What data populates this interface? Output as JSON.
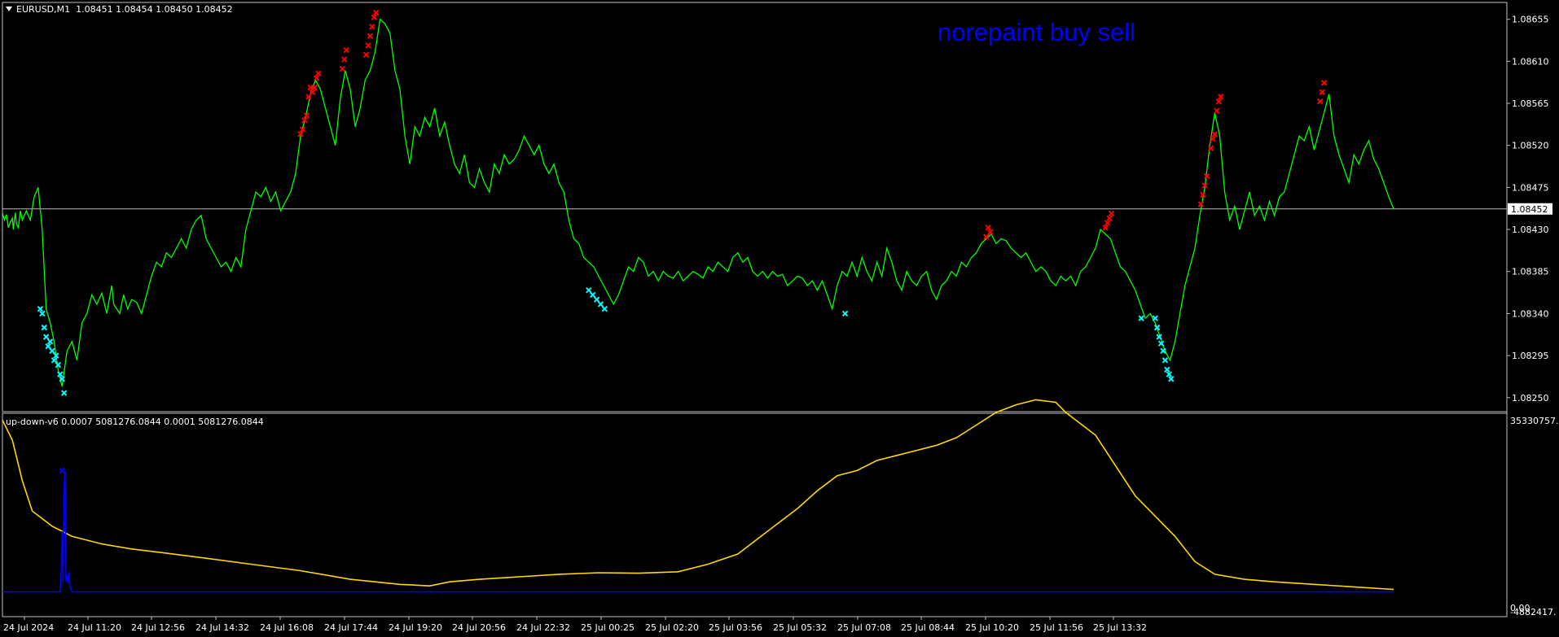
{
  "chart_data": [
    {
      "type": "line",
      "title": "EURUSD,M1",
      "ohlc": {
        "open": "1.08451",
        "high": "1.08454",
        "low": "1.08450",
        "close": "1.08452"
      },
      "y_ticks": [
        "1.08655",
        "1.08610",
        "1.08565",
        "1.08520",
        "1.08475",
        "1.08430",
        "1.08385",
        "1.08340",
        "1.08295",
        "1.08250"
      ],
      "ylim": [
        1.08235,
        1.08673
      ],
      "current_price": "1.08452",
      "series": [
        {
          "color": "#00ff00",
          "x": [
            0,
            2,
            4,
            6,
            8,
            10,
            11,
            12,
            13,
            14,
            16,
            18,
            20,
            24,
            28,
            32,
            36,
            40,
            44,
            48,
            52,
            56,
            60,
            65,
            70,
            75,
            80,
            85,
            90,
            95,
            100,
            105,
            110,
            112,
            118,
            122,
            126,
            130,
            135,
            140,
            145,
            150,
            155,
            160,
            165,
            170,
            175,
            180,
            185,
            190,
            195,
            200,
            205,
            210,
            215,
            220,
            225,
            230,
            235,
            240,
            245,
            250,
            255,
            260,
            265,
            270,
            275,
            280,
            285,
            290,
            295,
            300,
            305,
            310,
            315,
            320,
            325,
            330,
            335,
            340,
            345,
            350,
            355,
            360,
            365,
            370,
            375,
            380,
            385,
            390,
            395,
            400,
            405,
            410,
            415,
            420,
            425,
            430,
            435,
            440,
            445,
            450,
            455,
            460,
            465,
            470,
            475,
            480,
            485,
            490,
            495,
            500,
            505,
            510,
            515,
            520,
            525,
            530,
            535,
            540,
            545,
            550,
            555,
            560,
            565,
            570,
            575,
            580,
            585,
            590,
            595,
            600,
            605,
            610,
            615,
            620,
            625,
            630,
            635,
            640,
            645,
            650,
            655,
            660,
            665,
            670,
            675,
            680,
            685,
            690,
            695,
            700,
            705,
            710,
            715,
            720,
            725,
            730,
            735,
            740,
            745,
            750,
            755,
            760,
            765,
            770,
            775,
            780,
            785,
            790,
            795,
            800,
            805,
            810,
            815,
            820,
            825,
            830,
            835,
            840,
            845,
            850,
            855,
            860,
            865,
            870,
            875,
            880,
            885,
            890,
            895,
            900,
            905,
            910,
            915,
            920,
            925,
            930,
            935,
            940,
            945,
            950,
            955,
            960,
            965,
            970,
            975,
            980,
            985,
            990,
            995,
            1000,
            1005,
            1010,
            1015,
            1020,
            1025,
            1030,
            1035,
            1040,
            1045,
            1050,
            1055,
            1060,
            1065,
            1070,
            1075,
            1080,
            1085,
            1090,
            1095,
            1100,
            1105,
            1110,
            1115,
            1120,
            1125,
            1130,
            1135,
            1140,
            1145,
            1150,
            1155,
            1160,
            1165,
            1170,
            1175,
            1180,
            1185,
            1190,
            1195,
            1200,
            1205,
            1210,
            1215,
            1220,
            1225,
            1230,
            1235,
            1240,
            1245,
            1250,
            1255,
            1260,
            1265,
            1270,
            1275,
            1280,
            1285,
            1290,
            1295,
            1300,
            1305,
            1310,
            1315,
            1320,
            1325,
            1330,
            1335,
            1340,
            1345,
            1350,
            1355,
            1360,
            1365,
            1370,
            1375,
            1380,
            1385,
            1390,
            1395,
            1400
          ],
          "y": [
            1.08448,
            1.0844,
            1.08446,
            1.08432,
            1.08438,
            1.08442,
            1.0843,
            1.0844,
            1.08448,
            1.08436,
            1.08432,
            1.0845,
            1.0844,
            1.0845,
            1.0844,
            1.08465,
            1.08475,
            1.0843,
            1.08345,
            1.0833,
            1.0831,
            1.0828,
            1.08262,
            1.083,
            1.0831,
            1.0829,
            1.0833,
            1.0834,
            1.0836,
            1.0835,
            1.08362,
            1.0834,
            1.0837,
            1.0835,
            1.0834,
            1.0836,
            1.08345,
            1.08355,
            1.08352,
            1.0834,
            1.0836,
            1.0838,
            1.08395,
            1.0839,
            1.08405,
            1.084,
            1.0841,
            1.0842,
            1.0841,
            1.0843,
            1.0844,
            1.08445,
            1.0842,
            1.0841,
            1.084,
            1.0839,
            1.08395,
            1.08385,
            1.084,
            1.0839,
            1.0843,
            1.0845,
            1.0847,
            1.08465,
            1.08475,
            1.0846,
            1.0847,
            1.0845,
            1.0846,
            1.0847,
            1.0849,
            1.0853,
            1.0855,
            1.08575,
            1.0859,
            1.0858,
            1.0856,
            1.0854,
            1.0852,
            1.0857,
            1.086,
            1.0858,
            1.0854,
            1.0856,
            1.0859,
            1.086,
            1.0862,
            1.08655,
            1.0865,
            1.0864,
            1.086,
            1.0858,
            1.0853,
            1.085,
            1.0854,
            1.0853,
            1.0855,
            1.0854,
            1.0856,
            1.0853,
            1.08545,
            1.0852,
            1.085,
            1.0849,
            1.0851,
            1.0848,
            1.08475,
            1.08495,
            1.0848,
            1.0847,
            1.085,
            1.0849,
            1.0851,
            1.085,
            1.08505,
            1.08515,
            1.0853,
            1.0852,
            1.0851,
            1.0852,
            1.085,
            1.0849,
            1.085,
            1.0848,
            1.0847,
            1.0844,
            1.0842,
            1.08415,
            1.084,
            1.08395,
            1.0839,
            1.0838,
            1.0837,
            1.0836,
            1.0835,
            1.0836,
            1.08375,
            1.0839,
            1.08385,
            1.084,
            1.08395,
            1.0838,
            1.08385,
            1.08375,
            1.08385,
            1.0838,
            1.08378,
            1.08385,
            1.08375,
            1.0838,
            1.08385,
            1.08382,
            1.08378,
            1.0839,
            1.08385,
            1.08395,
            1.0839,
            1.08385,
            1.084,
            1.08405,
            1.08395,
            1.084,
            1.08385,
            1.0838,
            1.08385,
            1.08378,
            1.08385,
            1.0838,
            1.08382,
            1.0837,
            1.08375,
            1.0838,
            1.08378,
            1.0837,
            1.08375,
            1.08365,
            1.08375,
            1.0836,
            1.08345,
            1.0837,
            1.08385,
            1.0838,
            1.08395,
            1.0838,
            1.084,
            1.08385,
            1.08375,
            1.08395,
            1.0838,
            1.0841,
            1.08395,
            1.08375,
            1.08365,
            1.08385,
            1.08375,
            1.0837,
            1.0838,
            1.08385,
            1.08365,
            1.08355,
            1.0837,
            1.08375,
            1.08385,
            1.0838,
            1.08395,
            1.0839,
            1.084,
            1.08405,
            1.08415,
            1.0842,
            1.08425,
            1.08415,
            1.0842,
            1.08418,
            1.0841,
            1.08405,
            1.084,
            1.08405,
            1.08395,
            1.08385,
            1.0839,
            1.08385,
            1.08375,
            1.0837,
            1.0838,
            1.08375,
            1.0838,
            1.0837,
            1.08385,
            1.0839,
            1.084,
            1.0841,
            1.0843,
            1.08425,
            1.0842,
            1.08405,
            1.0839,
            1.08385,
            1.08375,
            1.08365,
            1.0835,
            1.08335,
            1.0834,
            1.0833,
            1.08315,
            1.083,
            1.0829,
            1.0831,
            1.0834,
            1.0837,
            1.0839,
            1.0841,
            1.08445,
            1.08475,
            1.0852,
            1.08555,
            1.0853,
            1.0847,
            1.0844,
            1.08455,
            1.0843,
            1.0845,
            1.0847,
            1.08445,
            1.08455,
            1.0844,
            1.0846,
            1.08445,
            1.08465,
            1.0847,
            1.0849,
            1.0851,
            1.0853,
            1.08525,
            1.0854,
            1.08515,
            1.08535,
            1.08555,
            1.08575,
            1.0853,
            1.0851,
            1.08495,
            1.0848,
            1.0851,
            1.085,
            1.08515,
            1.08525,
            1.08505,
            1.08495,
            1.0848,
            1.08465,
            1.08452
          ]
        }
      ],
      "sell_x": [
        300,
        302,
        304,
        306,
        308,
        310,
        312,
        314,
        316,
        318,
        342,
        344,
        346,
        366,
        368,
        370,
        372,
        374,
        376,
        990,
        992,
        994,
        1110,
        1112,
        1114,
        1116,
        1206,
        1208,
        1210,
        1212,
        1216,
        1218,
        1220,
        1222,
        1224,
        1226,
        1326,
        1328,
        1330
      ],
      "sell_y": [
        1.08532,
        1.08537,
        1.08547,
        1.08552,
        1.08572,
        1.08582,
        1.08577,
        1.08582,
        1.08592,
        1.08597,
        1.08602,
        1.08612,
        1.08622,
        1.08617,
        1.08627,
        1.08637,
        1.08647,
        1.08657,
        1.08662,
        1.08422,
        1.08432,
        1.08427,
        1.08432,
        1.08437,
        1.08442,
        1.08447,
        1.08457,
        1.08467,
        1.08477,
        1.08487,
        1.08517,
        1.08527,
        1.08532,
        1.08557,
        1.08567,
        1.08572,
        1.08567,
        1.08577,
        1.08587
      ],
      "buy_x": [
        38,
        40,
        42,
        44,
        46,
        48,
        50,
        52,
        54,
        56,
        58,
        60,
        62,
        590,
        594,
        598,
        602,
        606,
        848,
        1146,
        1160,
        1162,
        1164,
        1166,
        1168,
        1170,
        1172,
        1174,
        1176
      ],
      "buy_y": [
        1.08345,
        1.0834,
        1.08325,
        1.08315,
        1.08305,
        1.0831,
        1.083,
        1.0829,
        1.08295,
        1.08285,
        1.08275,
        1.0827,
        1.08255,
        1.08365,
        1.0836,
        1.08355,
        1.0835,
        1.08345,
        1.0834,
        1.08335,
        1.08335,
        1.08325,
        1.08315,
        1.08308,
        1.083,
        1.0829,
        1.0828,
        1.08275,
        1.0827
      ]
    },
    {
      "type": "line",
      "title": "up-down-v6",
      "values_label": "0.0007 5081276.0844 0.0001 5081276.0844",
      "y_top_label": "35330757.",
      "y_bottom_label": "-4882417.",
      "y_zero_label": "0.00",
      "ylim": [
        -4882417,
        35330757
      ],
      "series": [
        {
          "color": "#ffd700",
          "x": [
            0,
            10,
            20,
            30,
            40,
            50,
            60,
            70,
            80,
            100,
            130,
            160,
            200,
            250,
            300,
            350,
            400,
            430,
            450,
            480,
            520,
            560,
            600,
            640,
            680,
            710,
            740,
            770,
            800,
            820,
            840,
            860,
            880,
            900,
            920,
            940,
            960,
            980,
            1000,
            1020,
            1040,
            1060,
            1070,
            1080,
            1100,
            1120,
            1140,
            1160,
            1180,
            1200,
            1220,
            1250,
            1280,
            1320,
            1360,
            1400
          ],
          "y": [
            34000000,
            30000000,
            22000000,
            16000000,
            14500000,
            13000000,
            12000000,
            11000000,
            10500000,
            9500000,
            8500000,
            7800000,
            6800000,
            5500000,
            4200000,
            2500000,
            1500000,
            1200000,
            2000000,
            2500000,
            3000000,
            3500000,
            3800000,
            3700000,
            4000000,
            5500000,
            7500000,
            12000000,
            16500000,
            20000000,
            23000000,
            24000000,
            26000000,
            27000000,
            28000000,
            29000000,
            30500000,
            33000000,
            35500000,
            37000000,
            38000000,
            37500000,
            35500000,
            34000000,
            31000000,
            25000000,
            19000000,
            15000000,
            11000000,
            6000000,
            3500000,
            2500000,
            2000000,
            1500000,
            1000000,
            500000
          ]
        },
        {
          "color": "#0000ff",
          "x": [
            0,
            58,
            59,
            60,
            61,
            62,
            63,
            64,
            65,
            66,
            67,
            68,
            70,
            1400
          ],
          "y": [
            0,
            0,
            3000000,
            12000000,
            2000000,
            21000000,
            24000000,
            2000000,
            3500000,
            1500000,
            4000000,
            1000000,
            0,
            0
          ]
        }
      ]
    }
  ],
  "x_axis": {
    "labels": [
      "24 Jul 2024",
      "24 Jul 11:20",
      "24 Jul 12:56",
      "24 Jul 14:32",
      "24 Jul 16:08",
      "24 Jul 17:44",
      "24 Jul 19:20",
      "24 Jul 20:56",
      "24 Jul 22:32",
      "25 Jul 00:25",
      "25 Jul 02:20",
      "25 Jul 03:56",
      "25 Jul 05:32",
      "25 Jul 07:08",
      "25 Jul 08:44",
      "25 Jul 10:20",
      "25 Jul 11:56",
      "25 Jul 13:32"
    ],
    "label_x": [
      30,
      108,
      186,
      265,
      344,
      423,
      502,
      580,
      659,
      738,
      817,
      895,
      974,
      1053,
      1131,
      1210,
      1289,
      1367
    ]
  },
  "overlay_text": "norepaint buy sell",
  "colors": {
    "bg": "#000000",
    "frame": "#c0c0c0",
    "price_line": "#00ff00",
    "sell": "#ff0000",
    "buy": "#00ffff",
    "osc": "#ffd700",
    "osc2": "#0000ff",
    "hline": "#bcbcbc"
  }
}
